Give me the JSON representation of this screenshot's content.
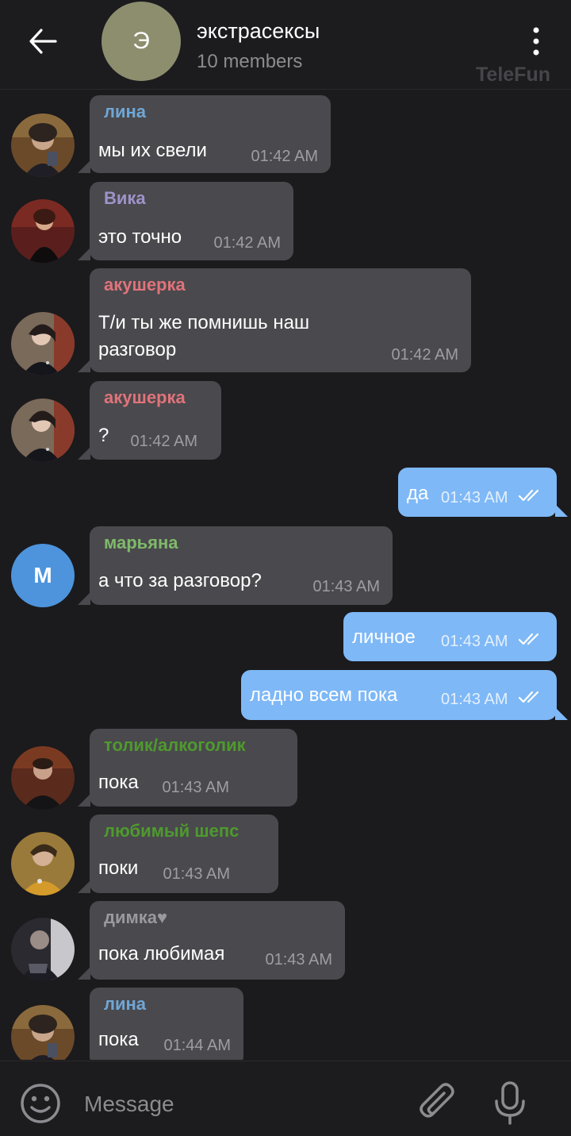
{
  "header": {
    "avatar_letter": "Э",
    "title": "экстрасексы",
    "subtitle": "10 members",
    "watermark": "TeleFun"
  },
  "colors": {
    "background": "#1b1a1d",
    "incoming_bubble": "#4a494d",
    "outgoing_bubble": "#7eb8f7",
    "avatar_chat": "#8d8e6e",
    "avatar_m": "#4d94dc"
  },
  "messages": [
    {
      "direction": "in",
      "sender": "лина",
      "sender_color": "#6fa7d6",
      "lines": [
        "мы их свели"
      ],
      "time": "01:42 AM"
    },
    {
      "direction": "in",
      "sender": "Вика",
      "sender_color": "#9e93c9",
      "lines": [
        "это точно"
      ],
      "time": "01:42 AM"
    },
    {
      "direction": "in",
      "sender": "акушерка",
      "sender_color": "#e0737a",
      "lines": [
        "Т/и ты же помнишь наш",
        "разговор"
      ],
      "time": "01:42 AM"
    },
    {
      "direction": "in",
      "sender": "акушерка",
      "sender_color": "#e0737a",
      "lines": [
        "?"
      ],
      "time": "01:42 AM"
    },
    {
      "direction": "out",
      "lines": [
        "да"
      ],
      "time": "01:43 AM",
      "status": "read"
    },
    {
      "direction": "in",
      "sender": "марьяна",
      "sender_color": "#7fba6a",
      "avatar_letter": "М",
      "lines": [
        "а что за разговор?"
      ],
      "time": "01:43 AM"
    },
    {
      "direction": "out",
      "lines": [
        "личное"
      ],
      "time": "01:43 AM",
      "status": "read"
    },
    {
      "direction": "out",
      "lines": [
        "ладно всем пока"
      ],
      "time": "01:43 AM",
      "status": "read"
    },
    {
      "direction": "in",
      "sender": "толик/алкоголик",
      "sender_color": "#4e9a2e",
      "lines": [
        "пока"
      ],
      "time": "01:43 AM"
    },
    {
      "direction": "in",
      "sender": "любимый шепс",
      "sender_color": "#4e9a2e",
      "lines": [
        "поки"
      ],
      "time": "01:43 AM"
    },
    {
      "direction": "in",
      "sender": "димка♥",
      "sender_color": "#9a999e",
      "lines": [
        "пока любимая"
      ],
      "time": "01:43 AM"
    },
    {
      "direction": "in",
      "sender": "лина",
      "sender_color": "#6fa7d6",
      "lines": [
        "пока"
      ],
      "time": "01:44 AM"
    }
  ],
  "input": {
    "placeholder": "Message"
  },
  "icons": {
    "back": "arrow-left-icon",
    "menu": "more-vertical-icon",
    "emoji": "smiley-icon",
    "attach": "paperclip-icon",
    "mic": "microphone-icon",
    "read": "double-check-icon"
  }
}
